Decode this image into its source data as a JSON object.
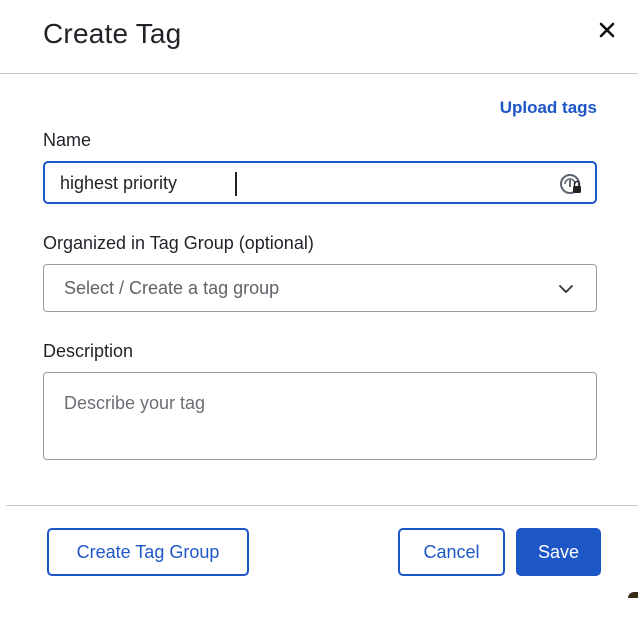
{
  "dialog": {
    "title": "Create Tag",
    "upload_link": "Upload tags"
  },
  "name": {
    "label": "Name",
    "value": "highest priority"
  },
  "tag_group": {
    "label": "Organized in Tag Group (optional)",
    "placeholder": "Select / Create a tag group"
  },
  "description": {
    "label": "Description",
    "placeholder": "Describe your tag",
    "value": ""
  },
  "footer": {
    "create_group_label": "Create Tag Group",
    "cancel_label": "Cancel",
    "save_label": "Save"
  },
  "icons": {
    "close": "close-icon",
    "password_manager": "password-manager-icon",
    "chevron": "chevron-down-icon"
  },
  "colors": {
    "accent": "#1d56c6",
    "text": "#1f2328",
    "placeholder": "#5f6368",
    "border": "#9a9a9a",
    "divider": "#c9c9c9"
  }
}
